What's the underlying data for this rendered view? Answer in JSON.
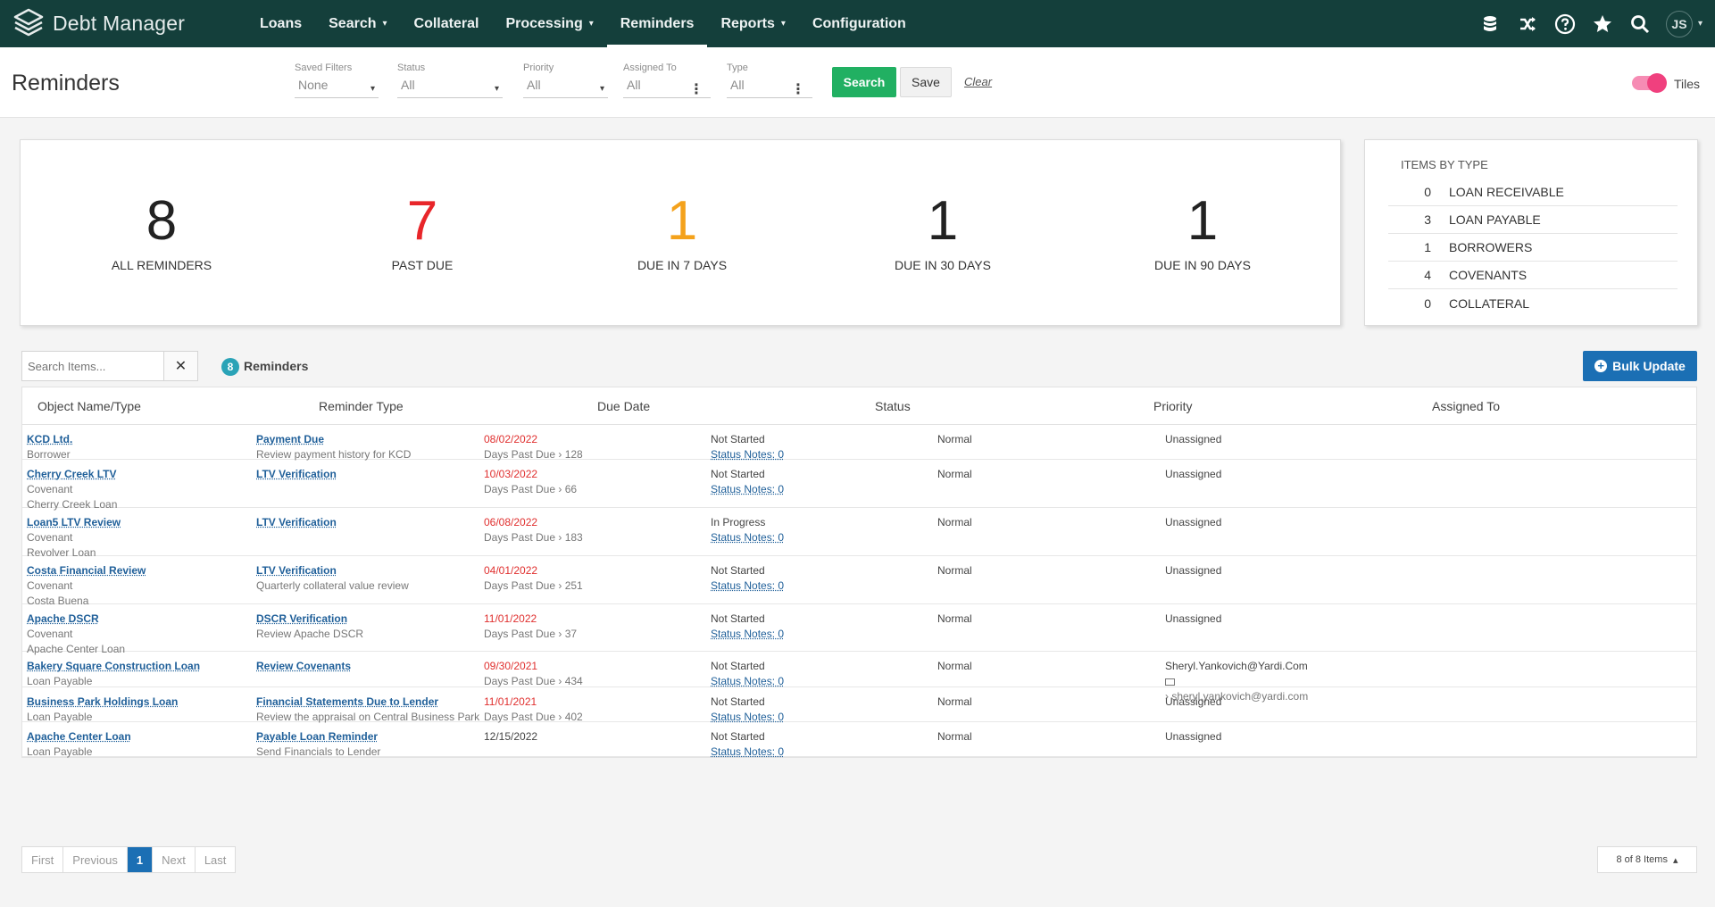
{
  "app": {
    "name": "Debt Manager",
    "user_initials": "JS"
  },
  "nav": {
    "items": [
      {
        "label": "Loans",
        "dropdown": false
      },
      {
        "label": "Search",
        "dropdown": true
      },
      {
        "label": "Collateral",
        "dropdown": false
      },
      {
        "label": "Processing",
        "dropdown": true
      },
      {
        "label": "Reminders",
        "dropdown": false,
        "active": true
      },
      {
        "label": "Reports",
        "dropdown": true
      },
      {
        "label": "Configuration",
        "dropdown": false
      }
    ],
    "caret": "▾",
    "icons": [
      "database-icon",
      "shuffle-icon",
      "help-icon",
      "star-icon",
      "search-icon",
      "avatar"
    ]
  },
  "page": {
    "title": "Reminders"
  },
  "filters": {
    "saved_filters": {
      "label": "Saved Filters",
      "value": "None"
    },
    "status": {
      "label": "Status",
      "value": "All"
    },
    "priority": {
      "label": "Priority",
      "value": "All"
    },
    "assigned_to": {
      "label": "Assigned To",
      "value": "All"
    },
    "type": {
      "label": "Type",
      "value": "All"
    },
    "search_label": "Search",
    "save_label": "Save",
    "clear_label": "Clear",
    "tiles_label": "Tiles",
    "tiles_on": true
  },
  "stats": [
    {
      "value": "8",
      "label": "ALL REMINDERS",
      "color": "#222222"
    },
    {
      "value": "7",
      "label": "PAST DUE",
      "color": "#e8262a"
    },
    {
      "value": "1",
      "label": "DUE IN 7 DAYS",
      "color": "#f4a21c"
    },
    {
      "value": "1",
      "label": "DUE IN 30 DAYS",
      "color": "#222222"
    },
    {
      "value": "1",
      "label": "DUE IN 90 DAYS",
      "color": "#222222"
    }
  ],
  "items_by_type": {
    "title": "ITEMS BY TYPE",
    "rows": [
      {
        "count": "0",
        "name": "LOAN RECEIVABLE"
      },
      {
        "count": "3",
        "name": "LOAN PAYABLE"
      },
      {
        "count": "1",
        "name": "BORROWERS"
      },
      {
        "count": "4",
        "name": "COVENANTS"
      },
      {
        "count": "0",
        "name": "COLLATERAL"
      }
    ]
  },
  "list": {
    "search_placeholder": "Search Items...",
    "count": "8",
    "count_label": "Reminders",
    "bulk_update_label": "Bulk Update"
  },
  "table": {
    "headers": [
      "Object Name/Type",
      "Reminder Type",
      "Due Date",
      "Status",
      "Priority",
      "Assigned To"
    ],
    "rows": [
      {
        "object": "KCD Ltd.",
        "object_lines": [
          "Borrower"
        ],
        "reminder": "Payment Due",
        "reminder_sub": "Review payment history for KCD",
        "due": "08/02/2022",
        "past_due": true,
        "days": "Days Past Due › 128",
        "status": "Not Started",
        "notes": "Status Notes: 0",
        "priority": "Normal",
        "assigned": "Unassigned",
        "assigned_email": ""
      },
      {
        "object": "Cherry Creek LTV",
        "object_lines": [
          "Covenant",
          "Cherry Creek Loan"
        ],
        "reminder": "LTV Verification",
        "reminder_sub": "",
        "due": "10/03/2022",
        "past_due": true,
        "days": "Days Past Due › 66",
        "status": "Not Started",
        "notes": "Status Notes: 0",
        "priority": "Normal",
        "assigned": "Unassigned",
        "assigned_email": ""
      },
      {
        "object": "Loan5 LTV Review",
        "object_lines": [
          "Covenant",
          "Revolver Loan"
        ],
        "reminder": "LTV Verification",
        "reminder_sub": "",
        "due": "06/08/2022",
        "past_due": true,
        "days": "Days Past Due › 183",
        "status": "In Progress",
        "notes": "Status Notes: 0",
        "priority": "Normal",
        "assigned": "Unassigned",
        "assigned_email": ""
      },
      {
        "object": "Costa Financial Review",
        "object_lines": [
          "Covenant",
          "Costa Buena"
        ],
        "reminder": "LTV Verification",
        "reminder_sub": "Quarterly collateral value review",
        "due": "04/01/2022",
        "past_due": true,
        "days": "Days Past Due › 251",
        "status": "Not Started",
        "notes": "Status Notes: 0",
        "priority": "Normal",
        "assigned": "Unassigned",
        "assigned_email": ""
      },
      {
        "object": "Apache DSCR",
        "object_lines": [
          "Covenant",
          "Apache Center Loan"
        ],
        "reminder": "DSCR Verification",
        "reminder_sub": "Review Apache DSCR",
        "due": "11/01/2022",
        "past_due": true,
        "days": "Days Past Due › 37",
        "status": "Not Started",
        "notes": "Status Notes: 0",
        "priority": "Normal",
        "assigned": "Unassigned",
        "assigned_email": ""
      },
      {
        "object": "Bakery Square Construction Loan",
        "object_lines": [
          "Loan Payable"
        ],
        "reminder": "Review Covenants",
        "reminder_sub": "",
        "due": "09/30/2021",
        "past_due": true,
        "days": "Days Past Due › 434",
        "status": "Not Started",
        "notes": "Status Notes: 0",
        "priority": "Normal",
        "assigned": "Sheryl.Yankovich@Yardi.Com",
        "assigned_email": "› sheryl.yankovich@yardi.com"
      },
      {
        "object": "Business Park Holdings Loan",
        "object_lines": [
          "Loan Payable"
        ],
        "reminder": "Financial Statements Due to Lender",
        "reminder_sub": "Review the appraisal on Central Business Park",
        "due": "11/01/2021",
        "past_due": true,
        "days": "Days Past Due › 402",
        "status": "Not Started",
        "notes": "Status Notes: 0",
        "priority": "Normal",
        "assigned": "Unassigned",
        "assigned_email": ""
      },
      {
        "object": "Apache Center Loan",
        "object_lines": [
          "Loan Payable"
        ],
        "reminder": "Payable Loan Reminder",
        "reminder_sub": "Send Financials to Lender",
        "due": "12/15/2022",
        "past_due": false,
        "days": "",
        "status": "Not Started",
        "notes": "Status Notes: 0",
        "priority": "Normal",
        "assigned": "Unassigned",
        "assigned_email": ""
      }
    ]
  },
  "pagination": {
    "first": "First",
    "previous": "Previous",
    "current": "1",
    "next": "Next",
    "last": "Last",
    "page_size": "8 of 8 Items",
    "page_size_caret": "▴"
  },
  "colors": {
    "nav_bg": "#143f3b",
    "search_green": "#21b062",
    "bulk_blue": "#1b6fb4",
    "past_due_red": "#e0302f"
  }
}
